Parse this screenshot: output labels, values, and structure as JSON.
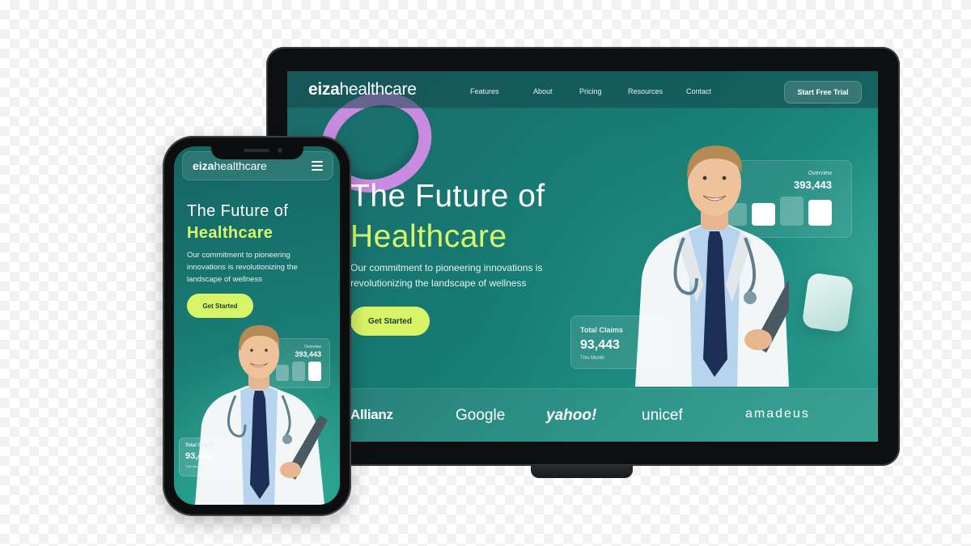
{
  "brand": {
    "name_bold": "eiza",
    "name_regular": "healthcare"
  },
  "laptop": {
    "nav": {
      "links": [
        "Features",
        "About",
        "Pricing",
        "Resources",
        "Contact"
      ],
      "cta": "Start Free Trial"
    },
    "hero": {
      "title_line1": "The Future of",
      "title_line2": "Healthcare",
      "subtitle": "Our commitment to pioneering innovations is revolutionizing the landscape of wellness",
      "cta": "Get Started"
    },
    "overview": {
      "label": "Overview",
      "value": "393,443"
    },
    "claims": {
      "label": "Total Claims",
      "value": "93,443",
      "sub": "This Month"
    },
    "partners": [
      "Allianz",
      "Google",
      "yahoo!",
      "unicef",
      "amadeus"
    ]
  },
  "phone": {
    "hero": {
      "title_line1": "The Future of",
      "title_line2": "Healthcare",
      "subtitle": "Our commitment to pioneering innovations is revolutionizing the landscape of wellness",
      "cta": "Get Started"
    },
    "overview": {
      "label": "Overview",
      "value": "393,443"
    },
    "claims": {
      "label": "Total Claims",
      "value": "93,443",
      "sub": "This Month"
    }
  },
  "colors": {
    "accent": "#d8f466",
    "teal_dark": "#146563",
    "teal_light": "#2a9b8c",
    "ring": "#c88be0",
    "device": "#0e0f10"
  }
}
